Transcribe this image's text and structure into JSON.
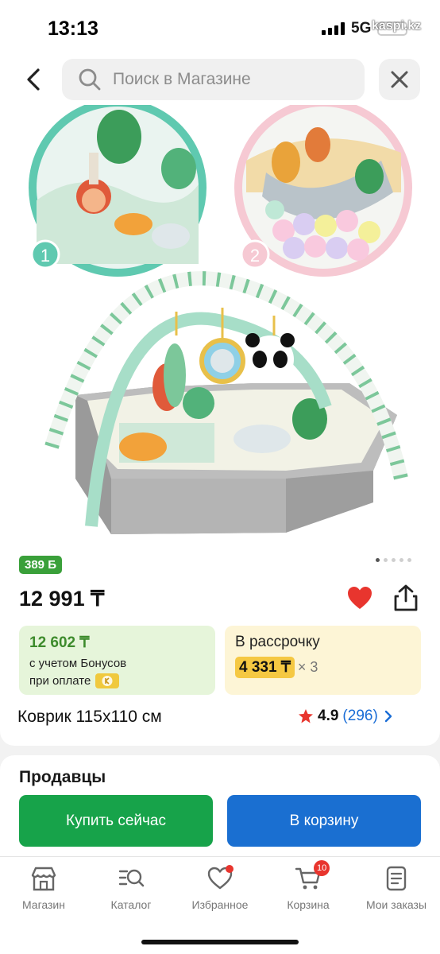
{
  "status_bar": {
    "time": "13:13",
    "network": "5G",
    "watermark": "kaspi.kz"
  },
  "header": {
    "search_placeholder": "Поиск в Магазине",
    "back_icon": "chevron-left-icon",
    "close_icon": "close-icon"
  },
  "product_image": {
    "callout_1": "1",
    "callout_2": "2",
    "gallery_total": 5,
    "gallery_active": 1
  },
  "product": {
    "bonus_badge": "389 Б",
    "price": "12 991 ₸",
    "title": "Коврик 115x110 см",
    "rating": "4.9",
    "reviews": "(296)",
    "favorite_color": "#e8352e"
  },
  "bonus_card": {
    "price": "12 602 ₸",
    "line1": "с учетом Бонусов",
    "line2": "при оплате"
  },
  "installment_card": {
    "label": "В рассрочку",
    "price": "4 331 ₸",
    "multiplier": "× 3"
  },
  "sellers": {
    "title": "Продавцы",
    "buy_now": "Купить сейчас",
    "add_to_cart": "В корзину",
    "buy_color": "#17a34a",
    "cart_color": "#1a6fd1"
  },
  "tabbar": {
    "items": [
      {
        "label": "Магазин",
        "icon": "store-icon"
      },
      {
        "label": "Каталог",
        "icon": "catalog-icon"
      },
      {
        "label": "Избранное",
        "icon": "heart-icon"
      },
      {
        "label": "Корзина",
        "icon": "cart-icon",
        "badge": "10"
      },
      {
        "label": "Мои заказы",
        "icon": "orders-icon"
      }
    ]
  }
}
